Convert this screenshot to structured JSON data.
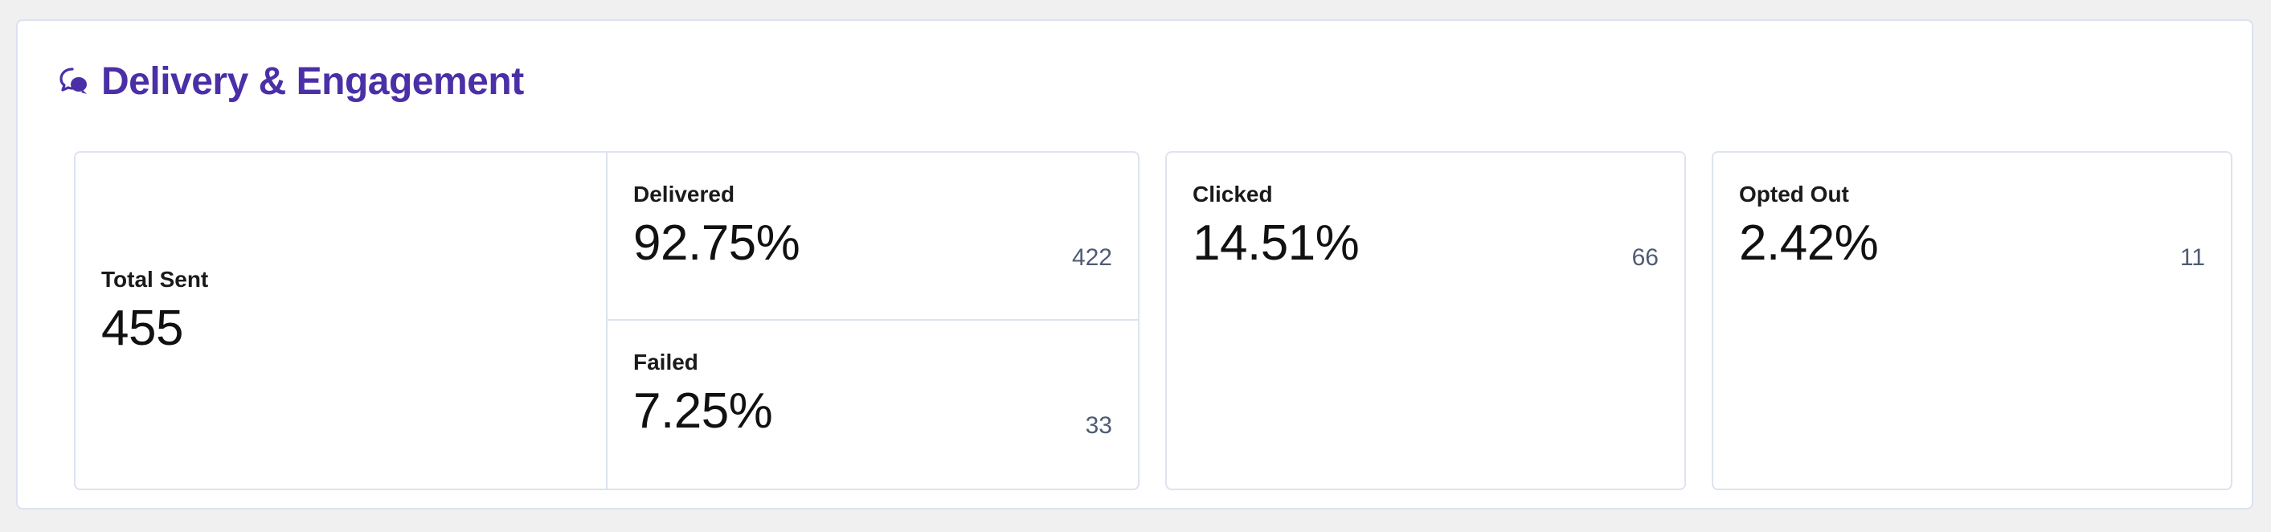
{
  "section": {
    "title": "Delivery & Engagement",
    "icon": "chat-bubbles-icon",
    "accent_color": "#4b2fa7"
  },
  "total_sent": {
    "label": "Total Sent",
    "value": "455"
  },
  "delivered": {
    "label": "Delivered",
    "percent": "92.75%",
    "count": "422"
  },
  "failed": {
    "label": "Failed",
    "percent": "7.25%",
    "count": "33"
  },
  "clicked": {
    "label": "Clicked",
    "percent": "14.51%",
    "count": "66"
  },
  "opted_out": {
    "label": "Opted Out",
    "percent": "2.42%",
    "count": "11"
  }
}
